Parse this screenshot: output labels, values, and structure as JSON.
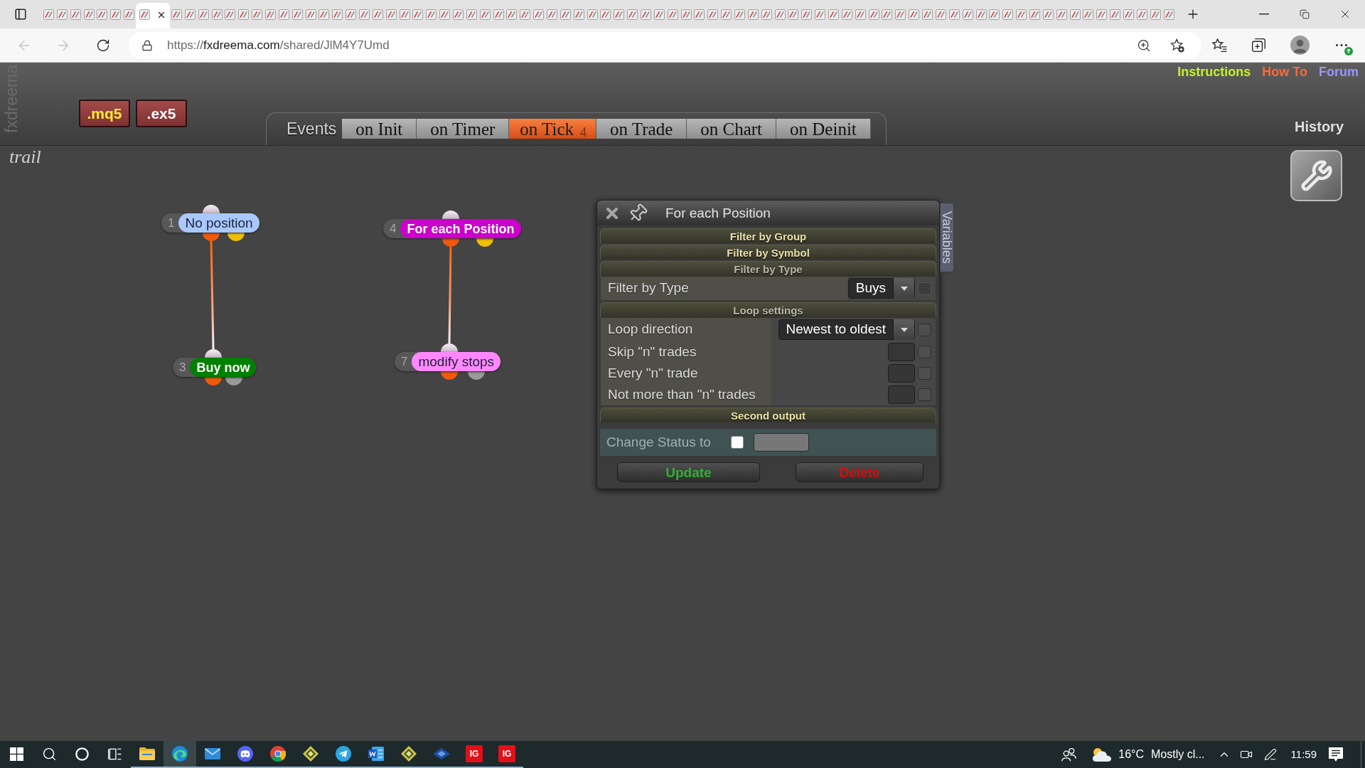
{
  "browser": {
    "tabs": [
      {
        "selected": false
      },
      {
        "selected": false
      },
      {
        "selected": false
      },
      {
        "selected": false
      },
      {
        "selected": false
      },
      {
        "selected": false
      },
      {
        "selected": false
      },
      {
        "selected": true
      },
      {
        "selected": false
      },
      {
        "selected": false
      },
      {
        "selected": false
      },
      {
        "selected": false
      },
      {
        "selected": false
      },
      {
        "selected": false
      },
      {
        "selected": false
      },
      {
        "selected": false
      },
      {
        "selected": false
      },
      {
        "selected": false
      },
      {
        "selected": false
      },
      {
        "selected": false
      },
      {
        "selected": false
      },
      {
        "selected": false
      },
      {
        "selected": false
      },
      {
        "selected": false
      },
      {
        "selected": false
      },
      {
        "selected": false
      },
      {
        "selected": false
      },
      {
        "selected": false
      },
      {
        "selected": false
      },
      {
        "selected": false
      },
      {
        "selected": false
      },
      {
        "selected": false
      },
      {
        "selected": false
      },
      {
        "selected": false
      },
      {
        "selected": false
      },
      {
        "selected": false
      },
      {
        "selected": false
      },
      {
        "selected": false
      },
      {
        "selected": false
      },
      {
        "selected": false
      },
      {
        "selected": false
      },
      {
        "selected": false
      },
      {
        "selected": false
      },
      {
        "selected": false
      },
      {
        "selected": false
      },
      {
        "selected": false
      },
      {
        "selected": false
      },
      {
        "selected": false
      },
      {
        "selected": false
      },
      {
        "selected": false
      },
      {
        "selected": false
      },
      {
        "selected": false
      },
      {
        "selected": false
      },
      {
        "selected": false
      },
      {
        "selected": false
      },
      {
        "selected": false
      },
      {
        "selected": false
      },
      {
        "selected": false
      },
      {
        "selected": false
      },
      {
        "selected": false
      },
      {
        "selected": false
      },
      {
        "selected": false
      },
      {
        "selected": false
      },
      {
        "selected": false
      },
      {
        "selected": false
      },
      {
        "selected": false
      },
      {
        "selected": false
      },
      {
        "selected": false
      },
      {
        "selected": false
      },
      {
        "selected": false
      },
      {
        "selected": false
      },
      {
        "selected": false
      },
      {
        "selected": false
      },
      {
        "selected": false
      },
      {
        "selected": false
      },
      {
        "selected": false
      },
      {
        "selected": false
      },
      {
        "selected": false
      },
      {
        "selected": false
      },
      {
        "selected": false
      },
      {
        "selected": false
      },
      {
        "selected": false
      },
      {
        "selected": false
      }
    ],
    "navigation": {
      "back_disabled": true,
      "forward_disabled": true
    },
    "url": {
      "scheme": "https://",
      "host": "fxdreema.com",
      "path": "/shared/JlM4Y7Umd"
    }
  },
  "header": {
    "brand": "fxdreema",
    "export_buttons": [
      {
        "label": ".mq5",
        "color": "#ffee33"
      },
      {
        "label": ".ex5",
        "color": "#ffffff"
      }
    ],
    "events_label": "Events",
    "event_tabs": [
      {
        "label": "on Init",
        "selected": false
      },
      {
        "label": "on Timer",
        "selected": false
      },
      {
        "label": "on Tick",
        "selected": true,
        "badge": "4"
      },
      {
        "label": "on Trade",
        "selected": false
      },
      {
        "label": "on Chart",
        "selected": false
      },
      {
        "label": "on Deinit",
        "selected": false
      }
    ],
    "links": [
      {
        "label": "Instructions",
        "color": "#c6f22a"
      },
      {
        "label": "How To",
        "color": "#ff6a3a"
      },
      {
        "label": "Forum",
        "color": "#9c94ff"
      }
    ],
    "history": "History"
  },
  "canvas": {
    "project_name": "trail",
    "blocks": [
      {
        "number": "1",
        "label": "No position",
        "color": "#a8c8ff",
        "outputs": [
          {
            "color": "#f05a0a"
          },
          {
            "color": "#f0c000"
          }
        ],
        "children": [
          {
            "number": "3",
            "label": "Buy now",
            "color": "#008000",
            "outputs": [
              {
                "color": "#f05a0a"
              },
              {
                "color": "#9a9a9a"
              }
            ]
          }
        ]
      },
      {
        "number": "4",
        "label": "For each Position",
        "color": "#cc00cc",
        "outputs": [
          {
            "color": "#f05a0a"
          },
          {
            "color": "#f0c000"
          }
        ],
        "children": [
          {
            "number": "7",
            "label": "modify stops",
            "color": "#ff88ff",
            "outputs": [
              {
                "color": "#f05a0a"
              },
              {
                "color": "#9a9a9a"
              }
            ]
          }
        ]
      }
    ]
  },
  "dialog": {
    "title": "For each Position",
    "side_tab": "Variables",
    "sections": [
      {
        "title": "Filter by Group",
        "expanded": false
      },
      {
        "title": "Filter by Symbol",
        "expanded": false
      },
      {
        "title": "Filter by Type",
        "expanded": true,
        "rows": [
          {
            "kind": "dropdown",
            "label": "Filter by Type",
            "value": "Buys",
            "checkbox": {
              "checked": false,
              "disabled": true
            }
          }
        ]
      },
      {
        "title": "Loop settings",
        "expanded": true,
        "rows": [
          {
            "kind": "dropdown",
            "label": "Loop direction",
            "value": "Newest to oldest",
            "checkbox": {
              "checked": false,
              "disabled": false
            }
          },
          {
            "kind": "number",
            "label": "Skip \"n\" trades",
            "checkbox": {
              "checked": false,
              "disabled": false
            }
          },
          {
            "kind": "number",
            "label": "Every \"n\" trade",
            "checkbox": {
              "checked": false,
              "disabled": false
            }
          },
          {
            "kind": "number",
            "label": "Not more than \"n\" trades",
            "checkbox": {
              "checked": false,
              "disabled": false
            }
          }
        ]
      },
      {
        "title": "Second output",
        "expanded": false
      }
    ],
    "status_row": {
      "label": "Change Status to",
      "checked": false
    },
    "buttons": [
      {
        "kind": "update",
        "label": "Update"
      },
      {
        "kind": "delete",
        "label": "Delete"
      }
    ]
  },
  "taskbar": {
    "apps": [
      {
        "kind": "start",
        "running": false,
        "selected": false
      },
      {
        "kind": "search",
        "running": false,
        "selected": false
      },
      {
        "kind": "assistant",
        "running": false,
        "selected": false
      },
      {
        "kind": "taskview",
        "running": false,
        "selected": false
      },
      {
        "kind": "folder",
        "running": true,
        "selected": false
      },
      {
        "kind": "browser",
        "running": true,
        "selected": true
      },
      {
        "kind": "mail",
        "running": true,
        "selected": false
      },
      {
        "kind": "chat",
        "running": true,
        "selected": false
      },
      {
        "kind": "globe",
        "running": true,
        "selected": false
      },
      {
        "kind": "diamond",
        "running": true,
        "selected": false
      },
      {
        "kind": "messenger",
        "running": true,
        "selected": false
      },
      {
        "kind": "document",
        "running": true,
        "selected": false
      },
      {
        "kind": "diamond",
        "running": true,
        "selected": false
      },
      {
        "kind": "kite",
        "running": true,
        "selected": false
      },
      {
        "kind": "logo",
        "logo_text": "IG",
        "running": true,
        "selected": false
      },
      {
        "kind": "logo",
        "logo_text": "IG",
        "running": true,
        "selected": false
      }
    ],
    "weather": {
      "temperature": "16°C",
      "summary": "Mostly cl..."
    },
    "clock": "11:59"
  }
}
